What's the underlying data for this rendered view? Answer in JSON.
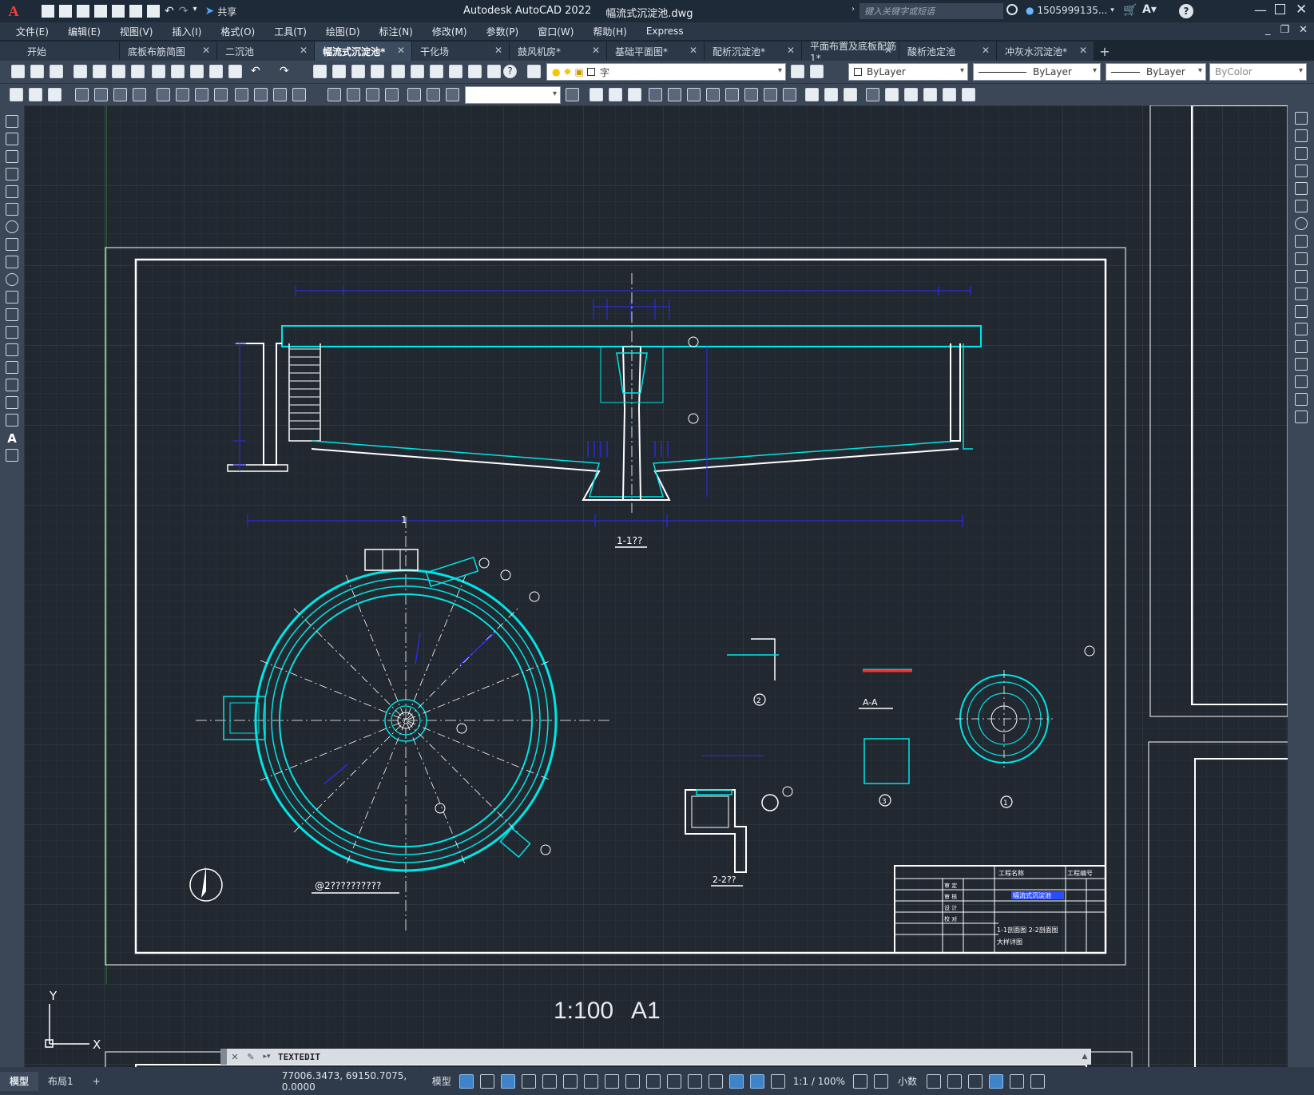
{
  "titlebar": {
    "app_title": "Autodesk AutoCAD 2022",
    "file_name": "幅流式沉淀池.dwg",
    "share_label": "共享",
    "search_placeholder": "键入关键字或短语",
    "user": "1505999135..."
  },
  "menu": [
    "文件(E)",
    "编辑(E)",
    "视图(V)",
    "插入(I)",
    "格式(O)",
    "工具(T)",
    "绘图(D)",
    "标注(N)",
    "修改(M)",
    "参数(P)",
    "窗口(W)",
    "帮助(H)",
    "Express"
  ],
  "tabs": [
    {
      "label": "开始",
      "active": false
    },
    {
      "label": "底板布筋简图",
      "active": false
    },
    {
      "label": "二沉池",
      "active": false
    },
    {
      "label": "幅流式沉淀池*",
      "active": true
    },
    {
      "label": "干化场",
      "active": false
    },
    {
      "label": "鼓风机房*",
      "active": false
    },
    {
      "label": "基础平面图*",
      "active": false
    },
    {
      "label": "配析沉淀池*",
      "active": false
    },
    {
      "label": "平面布置及底板配筋1*",
      "active": false
    },
    {
      "label": "酸析池定池",
      "active": false
    },
    {
      "label": "冲灰水沉淀池*",
      "active": false
    }
  ],
  "toolbar": {
    "layer_value": "字",
    "color_value": "ByLayer",
    "linetype_value": "ByLayer",
    "lineweight_value": "ByLayer",
    "plotstyle_value": "ByColor"
  },
  "drawing": {
    "section_title": "1-1??",
    "section_title_2": "2-2??",
    "detail_aa": "A-A",
    "plan_title": "@2??????????",
    "scale_label": "1:100",
    "sheet_size": "A1",
    "axis_y": "Y",
    "axis_x": "X",
    "section_mark": "1",
    "detail_1": "1",
    "detail_2": "2",
    "detail_3": "3",
    "title_block": {
      "project_label": "工程名称",
      "drawing_no_label": "工程编号",
      "row1": "幅流式沉淀池",
      "row2": "1-1剖面图 2-2剖面图",
      "row3": "大样详图",
      "approver": "审 定",
      "reviewer": "审 核",
      "designer": "设 计",
      "checker": "校 对"
    }
  },
  "command": {
    "current": "TEXTEDIT"
  },
  "status": {
    "layout_tabs": [
      "模型",
      "布局1"
    ],
    "coords": "77006.3473, 69150.7075, 0.0000",
    "model_label": "模型",
    "scale": "1:1 / 100%",
    "units": "小数"
  },
  "colors": {
    "canvas_bg": "#212830",
    "cyan": "#00e5e5",
    "blue": "#2a2dff",
    "white": "#ffffff",
    "green_axis": "#3ba54a"
  }
}
